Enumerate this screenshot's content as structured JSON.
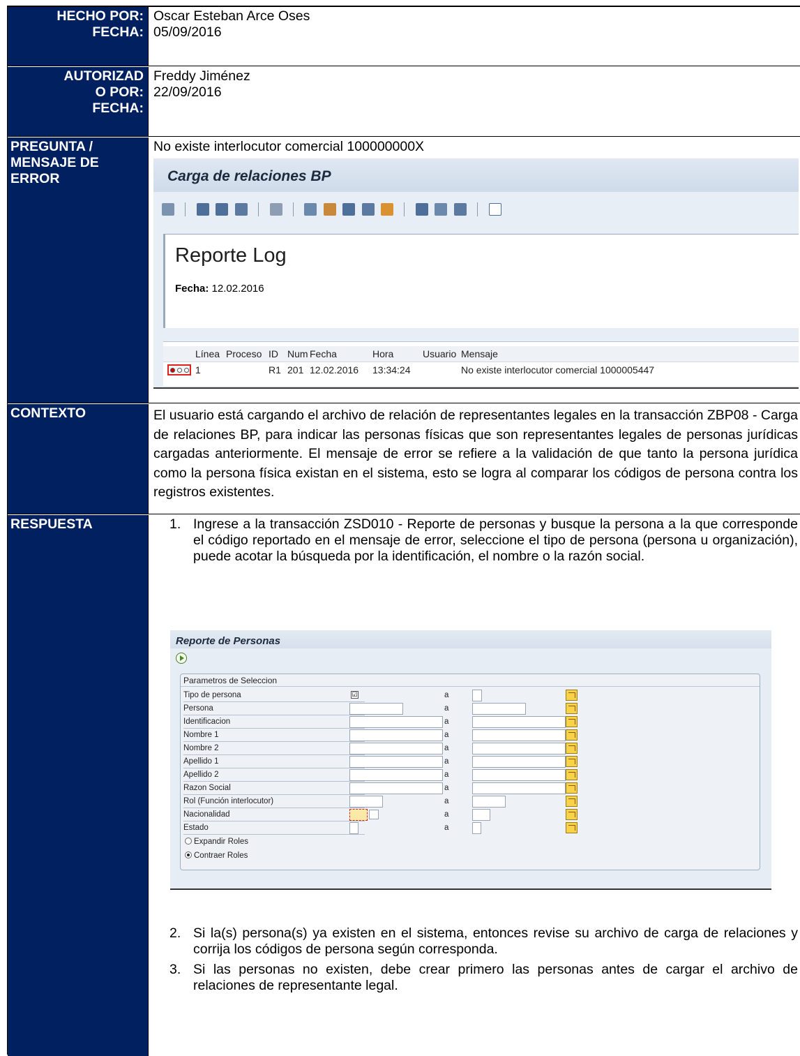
{
  "rows": {
    "hecho": {
      "label": "HECHO POR:\nFECHA:",
      "name": "Oscar Esteban Arce Oses",
      "date": "05/09/2016"
    },
    "autorizado": {
      "label": "AUTORIZAD\nO POR:\nFECHA:",
      "name": "Freddy Jiménez",
      "date": "22/09/2016"
    },
    "pregunta": {
      "label": "PREGUNTA /\nMENSAJE DE\nERROR",
      "text": "No existe interlocutor comercial 100000000X"
    },
    "contexto": {
      "label": "CONTEXTO",
      "text": "El usuario está cargando el archivo de relación de representantes legales en la transacción ZBP08 - Carga de relaciones BP, para indicar las personas físicas que son representantes legales de personas jurídicas cargadas anteriormente. El mensaje de error se refiere a la validación de que tanto la persona jurídica como la persona física existan en el sistema, esto se logra al comparar los códigos de persona contra los registros existentes."
    },
    "respuesta": {
      "label": "RESPUESTA",
      "steps": [
        {
          "num": "1.",
          "text": "Ingrese a la transacción ZSD010 - Reporte de personas y busque la persona a la que corresponde el código reportado en el mensaje de error, seleccione el tipo de persona (persona u organización), puede acotar la búsqueda por la identificación, el nombre o la razón social."
        },
        {
          "num": "2.",
          "text": "Si la(s) persona(s) ya existen en el sistema, entonces revise su archivo de carga de relaciones y corrija los códigos de persona según corresponda."
        },
        {
          "num": "3.",
          "text": "Si las personas no existen, debe crear primero las personas antes de cargar el archivo de relaciones de representante legal."
        }
      ]
    }
  },
  "screen1": {
    "title": "Carga de relaciones BP",
    "panel_title": "Reporte Log",
    "date_label": "Fecha:",
    "date_value": "12.02.2016",
    "columns": [
      "Línea",
      "Proceso",
      "ID",
      "Num",
      "Fecha",
      "Hora",
      "Usuario",
      "Mensaje"
    ],
    "row": {
      "linea": "1",
      "proceso": "",
      "id": "R1",
      "num": "201",
      "fecha": "12.02.2016",
      "hora": "13:34:24",
      "usuario": "",
      "mensaje": "No existe interlocutor comercial 1000005447"
    },
    "toolbar_icons": [
      "find-icon",
      "sort-asc-icon",
      "sort-desc-icon",
      "filter-icon",
      "print-preview-icon",
      "export-icon",
      "change-layout-icon",
      "save-layout-icon",
      "sum-icon",
      "graphic-icon",
      "grid-icon",
      "column-icon",
      "details-icon",
      "info-icon"
    ]
  },
  "screen2": {
    "title": "Reporte de Personas",
    "group_title": "Parametros de Seleccion",
    "to_label": "a",
    "params": [
      "Tipo de persona",
      "Persona",
      "Identificacion",
      "Nombre 1",
      "Nombre 2",
      "Apellido 1",
      "Apellido 2",
      "Razon Social",
      "Rol (Función interlocutor)",
      "Nacionalidad",
      "Estado"
    ],
    "radio_expand": "Expandir Roles",
    "radio_contract": "Contraer Roles",
    "radio_selected": "Contraer Roles"
  },
  "colors": {
    "label_bg": "#002060",
    "label_fg": "#ffffff"
  }
}
